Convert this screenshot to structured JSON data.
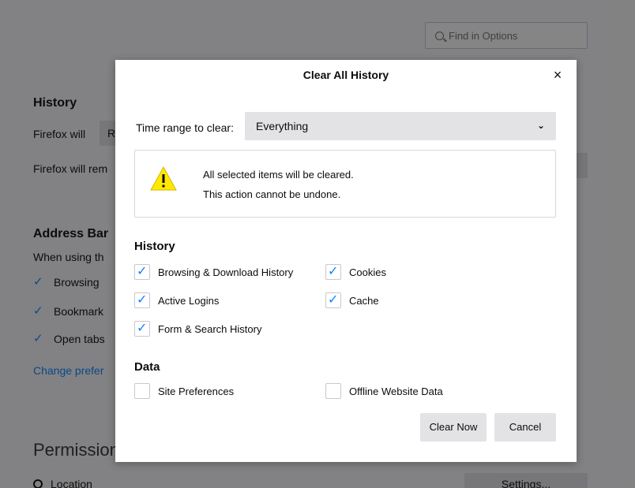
{
  "background": {
    "search_placeholder": "Find in Options",
    "history_heading": "History",
    "firefox_will": "Firefox will",
    "select_value": "R",
    "firefox_will_remember": "Firefox will rem",
    "address_bar_heading": "Address Bar",
    "when_using": "When using th",
    "check_browsing": "Browsing",
    "check_bookmarks": "Bookmark",
    "check_open_tabs": "Open tabs",
    "change_prefs_link": "Change prefer",
    "permissions_heading": "Permission",
    "location_label": "Location",
    "settings_button": "Settings..."
  },
  "dialog": {
    "title": "Clear All History",
    "close_glyph": "×",
    "time_range_label": "Time range to clear:",
    "time_range_value": "Everything",
    "warning_line1": "All selected items will be cleared.",
    "warning_line2": "This action cannot be undone.",
    "history_heading": "History",
    "data_heading": "Data",
    "history_options": [
      {
        "label": "Browsing & Download History",
        "checked": true
      },
      {
        "label": "Cookies",
        "checked": true
      },
      {
        "label": "Active Logins",
        "checked": true
      },
      {
        "label": "Cache",
        "checked": true
      },
      {
        "label": "Form & Search History",
        "checked": true
      }
    ],
    "data_options": [
      {
        "label": "Site Preferences",
        "checked": false
      },
      {
        "label": "Offline Website Data",
        "checked": false
      }
    ],
    "clear_now_button": "Clear Now",
    "cancel_button": "Cancel"
  },
  "colors": {
    "accent": "#0a84ff",
    "warning": "#ffe900",
    "button_bg": "#e3e3e6"
  }
}
